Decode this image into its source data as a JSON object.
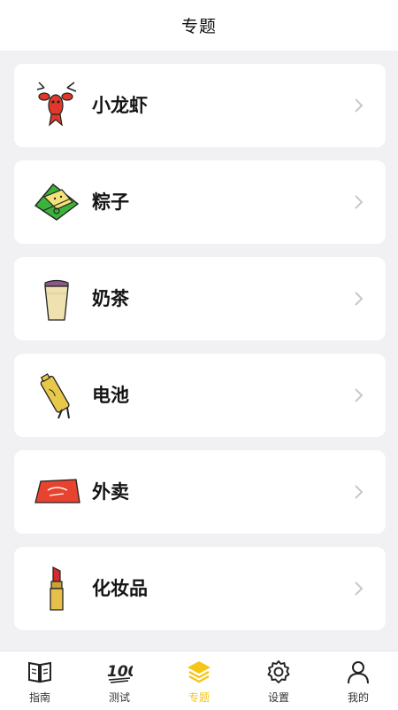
{
  "header": {
    "title": "专题"
  },
  "topics": [
    {
      "label": "小龙虾",
      "icon": "crayfish-icon"
    },
    {
      "label": "粽子",
      "icon": "zongzi-icon"
    },
    {
      "label": "奶茶",
      "icon": "milk-tea-icon"
    },
    {
      "label": "电池",
      "icon": "battery-icon"
    },
    {
      "label": "外卖",
      "icon": "takeout-bag-icon"
    },
    {
      "label": "化妆品",
      "icon": "lipstick-icon"
    }
  ],
  "tabs": [
    {
      "label": "指南",
      "icon": "book-icon",
      "active": false
    },
    {
      "label": "测试",
      "icon": "hundred-icon",
      "active": false
    },
    {
      "label": "专题",
      "icon": "layers-icon",
      "active": true
    },
    {
      "label": "设置",
      "icon": "gear-icon",
      "active": false
    },
    {
      "label": "我的",
      "icon": "user-icon",
      "active": false
    }
  ],
  "colors": {
    "accent": "#f5c518",
    "background": "#f1f0f2",
    "card": "#ffffff"
  }
}
